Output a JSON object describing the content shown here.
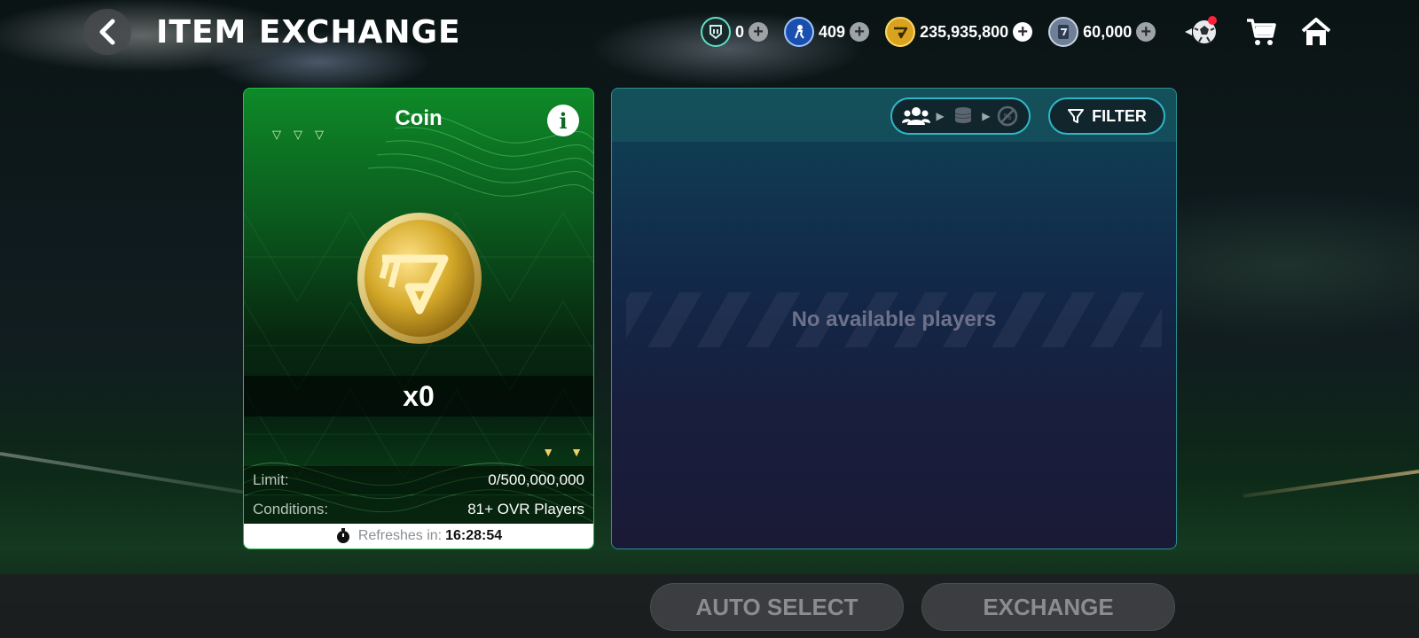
{
  "header": {
    "title": "ITEM EXCHANGE",
    "currencies": [
      {
        "icon": "rank-token-icon",
        "value": "0"
      },
      {
        "icon": "player-token-icon",
        "value": "409"
      },
      {
        "icon": "fc-coin-icon",
        "value": "235,935,800"
      },
      {
        "icon": "fc-points-icon",
        "value": "60,000"
      }
    ]
  },
  "card": {
    "title": "Coin",
    "quantity": "x0",
    "limit_label": "Limit:",
    "limit_value": "0/500,000,000",
    "conditions_label": "Conditions:",
    "conditions_value": "81+ OVR Players",
    "refresh_label": "Refreshes in:",
    "refresh_time": "16:28:54"
  },
  "panel": {
    "filter_label": "FILTER",
    "empty_message": "No available players"
  },
  "actions": {
    "auto_select_label": "AUTO SELECT",
    "exchange_label": "EXCHANGE"
  },
  "colors": {
    "card_green": "#0b5a1e",
    "accent_cyan": "#2fb6c9",
    "coin_gold": "#d4a92a",
    "notification_red": "#ff1f3a"
  }
}
